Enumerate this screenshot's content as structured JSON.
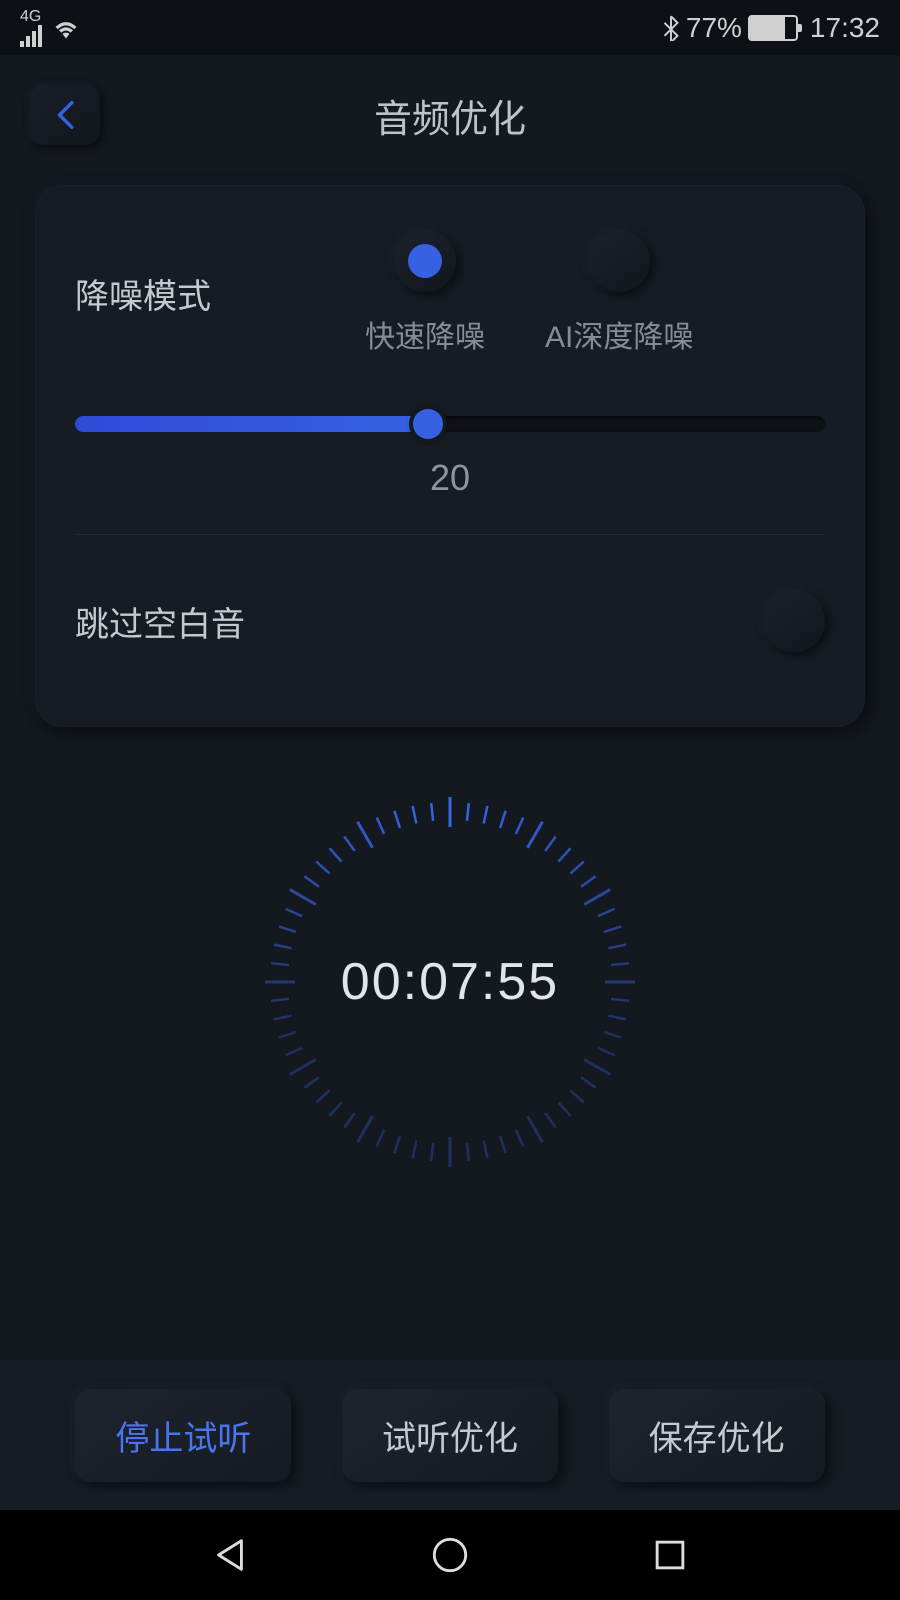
{
  "statusBar": {
    "network": "4G",
    "battery": "77%",
    "time": "17:32"
  },
  "header": {
    "title": "音频优化"
  },
  "noiseReduction": {
    "label": "降噪模式",
    "options": [
      {
        "label": "快速降噪",
        "selected": true
      },
      {
        "label": "AI深度降噪",
        "selected": false
      }
    ],
    "sliderValue": "20"
  },
  "skipSilence": {
    "label": "跳过空白音",
    "enabled": false
  },
  "timer": {
    "value": "00:07:55"
  },
  "actions": {
    "stopPreview": "停止试听",
    "preview": "试听优化",
    "save": "保存优化"
  }
}
